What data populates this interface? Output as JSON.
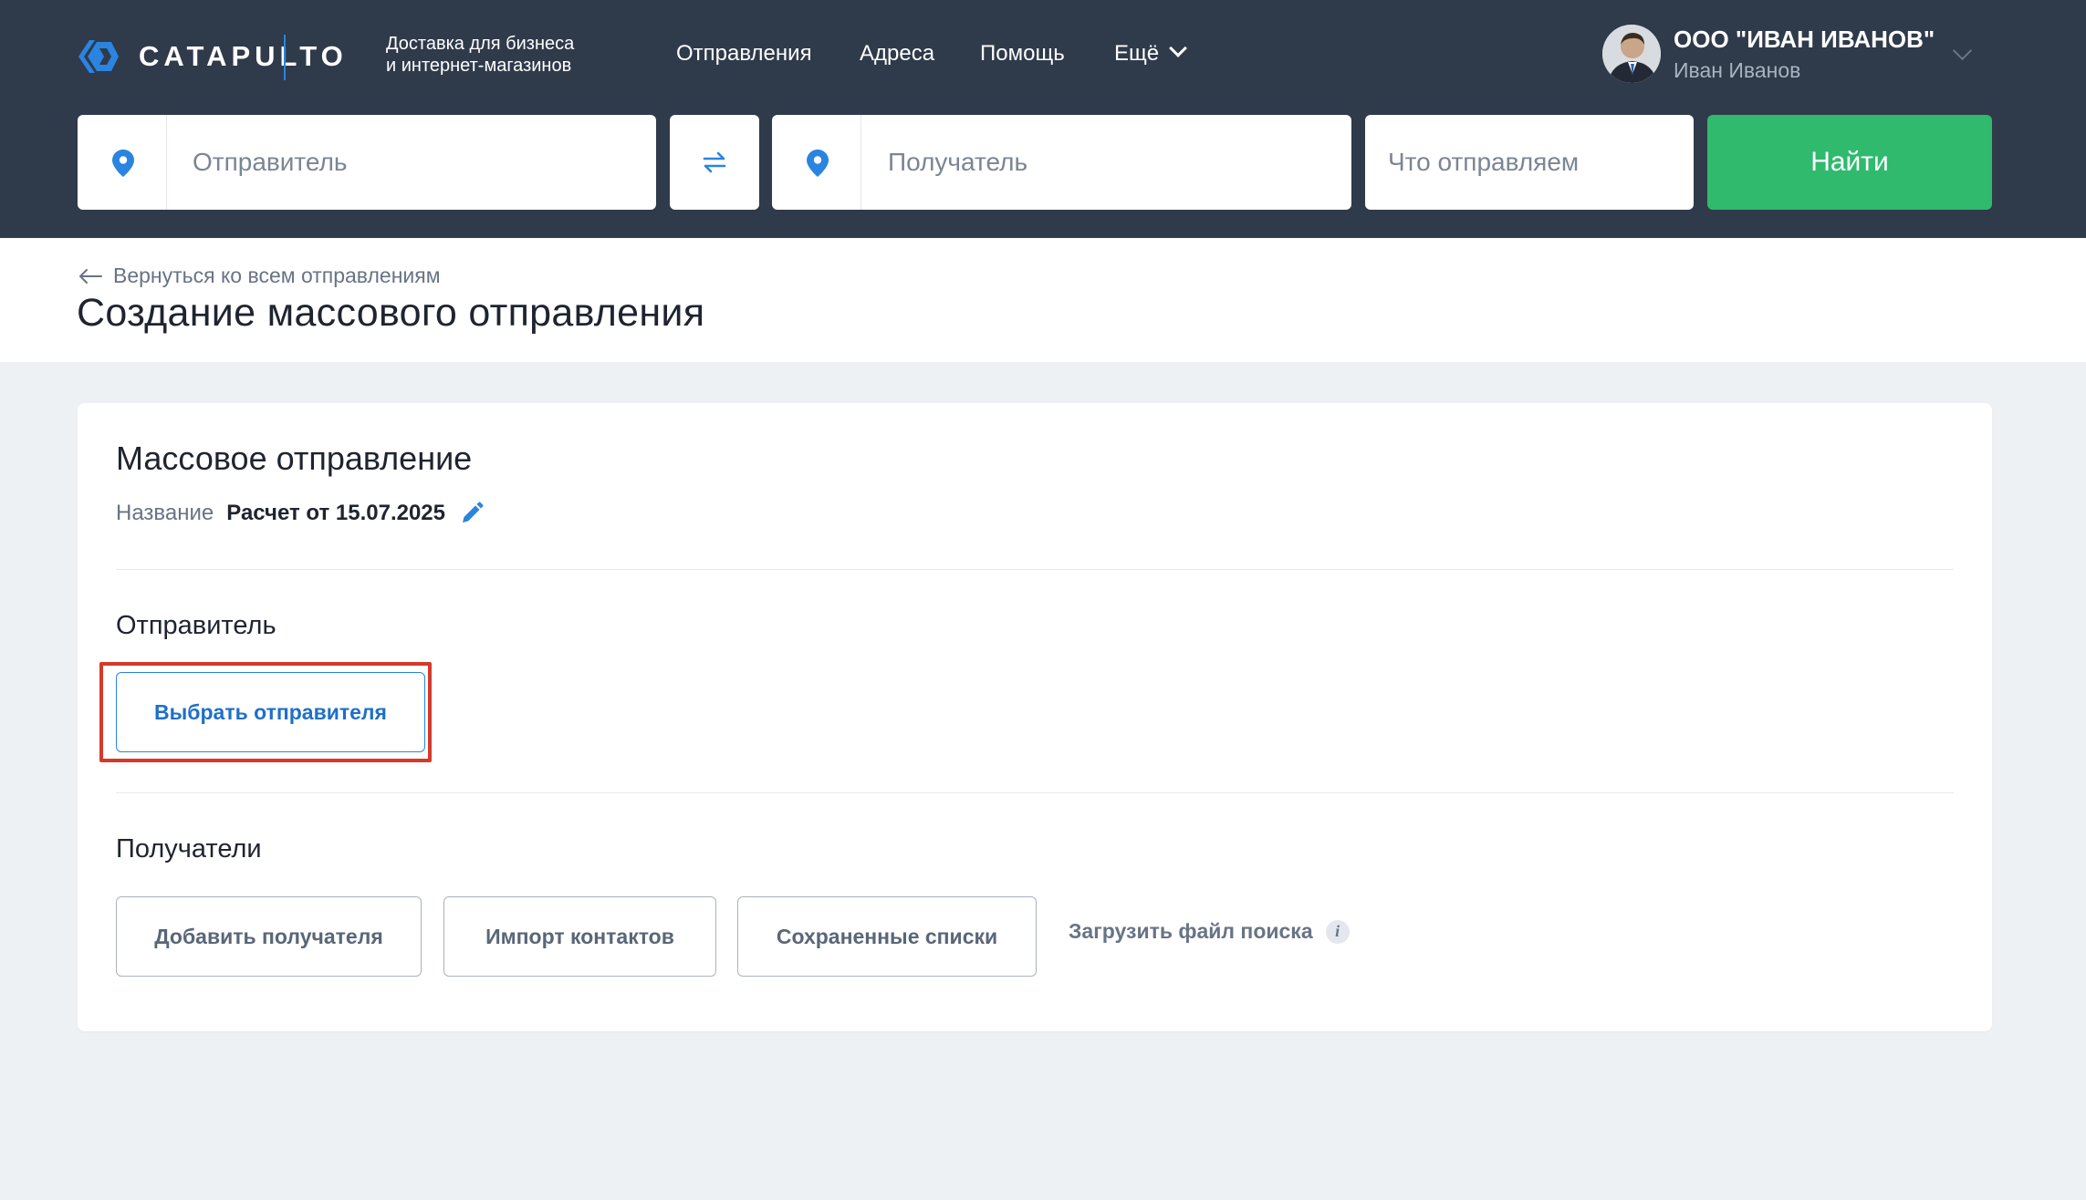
{
  "header": {
    "logo_text": "CATAPULTO",
    "tagline_line1": "Доставка для бизнеса",
    "tagline_line2": "и интернет-магазинов",
    "nav": [
      "Отправления",
      "Адреса",
      "Помощь",
      "Ещё"
    ],
    "company": "ООО \"ИВАН ИВАНОВ\"",
    "username": "Иван Иванов"
  },
  "search": {
    "sender_placeholder": "Отправитель",
    "recipient_placeholder": "Получатель",
    "what_placeholder": "Что отправляем",
    "find_label": "Найти"
  },
  "titlebar": {
    "back_label": "Вернуться ко всем отправлениям",
    "page_title": "Создание массового отправления"
  },
  "card": {
    "title": "Массовое отправление",
    "name_label": "Название",
    "name_value": "Расчет от 15.07.2025",
    "sender_section": "Отправитель",
    "choose_sender_label": "Выбрать отправителя",
    "recipients_section": "Получатели",
    "add_recipient_label": "Добавить получателя",
    "import_contacts_label": "Импорт контактов",
    "saved_lists_label": "Сохраненные списки",
    "upload_search_file_label": "Загрузить файл поиска",
    "info_symbol": "i"
  },
  "colors": {
    "header_bg": "#2f3a4a",
    "accent_blue": "#2a84e0",
    "find_green": "#2fba6e",
    "highlight_red": "#d43a2b",
    "page_bg": "#eef1f4"
  }
}
